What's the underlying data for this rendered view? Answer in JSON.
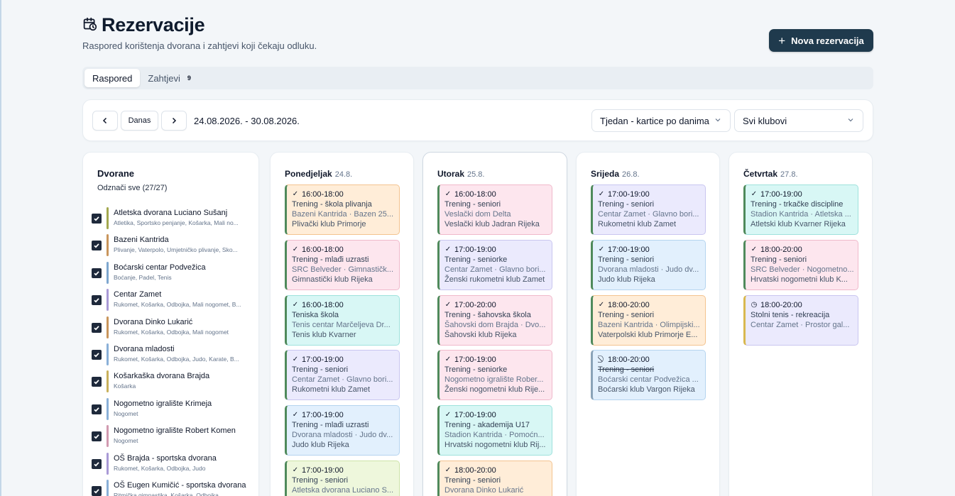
{
  "page": {
    "title": "Rezervacije",
    "subtitle": "Raspored korištenja dvorana i zahtjevi koji čekaju odluku.",
    "new_button": "Nova rezervacija"
  },
  "tabs": [
    {
      "label": "Raspored",
      "active": true
    },
    {
      "label": "Zahtjevi",
      "badge": "9"
    }
  ],
  "toolbar": {
    "today": "Danas",
    "range": "24.08.2026. - 30.08.2026.",
    "view_select": "Tjedan - kartice po danima",
    "club_select": "Svi klubovi"
  },
  "halls": {
    "title": "Dvorane",
    "select_all": "Odznači sve (27/27)",
    "items": [
      {
        "name": "Atletska dvorana Luciano Sušanj",
        "sports": "Atletika, Sportsko penjanje, Košarka, Mali no...",
        "color": "#a3a84f"
      },
      {
        "name": "Bazeni Kantrida",
        "sports": "Plivanje, Vaterpolo, Umjetničko plivanje, Sko...",
        "color": "#c9955c"
      },
      {
        "name": "Boćarski centar Podvežica",
        "sports": "Boćanje, Padel, Tenis",
        "color": "#7ea7cf"
      },
      {
        "name": "Centar Zamet",
        "sports": "Rukomet, Košarka, Odbojka, Mali nogomet, B...",
        "color": "#a99ad6"
      },
      {
        "name": "Dvorana Dinko Lukarić",
        "sports": "Rukomet, Košarka, Odbojka, Mali nogomet",
        "color": "#c9955c"
      },
      {
        "name": "Dvorana mladosti",
        "sports": "Rukomet, Košarka, Odbojka, Judo, Karate, B...",
        "color": "#8ab0d8"
      },
      {
        "name": "Košarkaška dvorana Brajda",
        "sports": "Košarka",
        "color": "#c9b15c"
      },
      {
        "name": "Nogometno igralište Krimeja",
        "sports": "Nogomet",
        "color": "#8ab0d8"
      },
      {
        "name": "Nogometno igralište Robert Komen",
        "sports": "Nogomet",
        "color": "#d19ab0"
      },
      {
        "name": "OŠ Brajda - sportska dvorana",
        "sports": "Rukomet, Košarka, Odbojka, Judo",
        "color": "#a99ad6"
      },
      {
        "name": "OŠ Eugen Kumičić - sportska dvorana",
        "sports": "Ritmička gimnastika, Košarka, Odbojka",
        "color": "#8ab0d8"
      }
    ]
  },
  "days": [
    {
      "name": "Ponedjeljak",
      "date": "24.8.",
      "cards": [
        {
          "icon": "✓",
          "time": "16:00-18:00",
          "title": "Trening - škola plivanja",
          "place": "Bazeni Kantrida · Bazen 25...",
          "club": "Plivački klub Primorje",
          "theme": "orange"
        },
        {
          "icon": "✓",
          "time": "16:00-18:00",
          "title": "Trening - mlađi uzrasti",
          "place": "SRC Belveder · Gimnastičk...",
          "club": "Gimnastički klub Rijeka",
          "theme": "pink"
        },
        {
          "icon": "✓",
          "time": "16:00-18:00",
          "title": "Teniska škola",
          "place": "Tenis centar Marčeljeva Dr...",
          "club": "Tenis klub Kvarner",
          "theme": "teal"
        },
        {
          "icon": "✓",
          "time": "17:00-19:00",
          "title": "Trening - seniori",
          "place": "Centar Zamet · Glavno bori...",
          "club": "Rukometni klub Zamet",
          "theme": "lavender"
        },
        {
          "icon": "✓",
          "time": "17:00-19:00",
          "title": "Trening - mlađi uzrasti",
          "place": "Dvorana mladosti · Judo dv...",
          "club": "Judo klub Rijeka",
          "theme": "blue"
        },
        {
          "icon": "✓",
          "time": "17:00-19:00",
          "title": "Trening - seniori",
          "place": "Atletska dvorana Luciano S...",
          "club": "",
          "theme": "olive"
        }
      ]
    },
    {
      "name": "Utorak",
      "date": "25.8.",
      "cards": [
        {
          "icon": "✓",
          "time": "16:00-18:00",
          "title": "Trening - seniori",
          "place": "Veslački dom Delta",
          "club": "Veslački klub Jadran Rijeka",
          "theme": "pink"
        },
        {
          "icon": "✓",
          "time": "17:00-19:00",
          "title": "Trening - seniorke",
          "place": "Centar Zamet · Glavno bori...",
          "club": "Ženski rukometni klub Zamet",
          "theme": "lavender"
        },
        {
          "icon": "✓",
          "time": "17:00-20:00",
          "title": "Trening - šahovska škola",
          "place": "Šahovski dom Brajda · Dvo...",
          "club": "Šahovski klub Rijeka",
          "theme": "pink"
        },
        {
          "icon": "✓",
          "time": "17:00-19:00",
          "title": "Trening - seniorke",
          "place": "Nogometno igralište Rober...",
          "club": "Ženski nogometni klub Rije...",
          "theme": "pink"
        },
        {
          "icon": "✓",
          "time": "17:00-19:00",
          "title": "Trening - akademija U17",
          "place": "Stadion Kantrida · Pomoćn...",
          "club": "Hrvatski nogometni klub Rij...",
          "theme": "teal"
        },
        {
          "icon": "✓",
          "time": "18:00-20:00",
          "title": "Trening - seniori",
          "place": "Dvorana Dinko Lukarić",
          "club": "",
          "theme": "orange"
        }
      ]
    },
    {
      "name": "Srijeda",
      "date": "26.8.",
      "cards": [
        {
          "icon": "✓",
          "time": "17:00-19:00",
          "title": "Trening - seniori",
          "place": "Centar Zamet · Glavno bori...",
          "club": "Rukometni klub Zamet",
          "theme": "lavender"
        },
        {
          "icon": "✓",
          "time": "17:00-19:00",
          "title": "Trening - seniori",
          "place": "Dvorana mladosti · Judo dv...",
          "club": "Judo klub Rijeka",
          "theme": "blue"
        },
        {
          "icon": "✓",
          "time": "18:00-20:00",
          "title": "Trening - seniori",
          "place": "Bazeni Kantrida · Olimpijski...",
          "club": "Vaterpolski klub Primorje E...",
          "theme": "orange"
        },
        {
          "icon": "⃠",
          "time": "18:00-20:00",
          "title": "Trening - seniori",
          "place": "Boćarski centar Podvežica ...",
          "club": "Boćarski klub Vargon Rijeka",
          "theme": "blue",
          "cancelled": true
        }
      ]
    },
    {
      "name": "Četvrtak",
      "date": "27.8.",
      "cards": [
        {
          "icon": "✓",
          "time": "17:00-19:00",
          "title": "Trening - trkačke discipline",
          "place": "Stadion Kantrida · Atletska ...",
          "club": "Atletski klub Kvarner Rijeka",
          "theme": "teal"
        },
        {
          "icon": "✓",
          "time": "18:00-20:00",
          "title": "Trening - seniori",
          "place": "SRC Belveder · Nogometno...",
          "club": "Hrvatski nogometni klub K...",
          "theme": "pink"
        },
        {
          "icon": "◷",
          "time": "18:00-20:00",
          "title": "Stolni tenis - rekreacija",
          "place": "Centar Zamet · Prostor gal...",
          "club": "",
          "theme": "lavender-pending"
        }
      ]
    }
  ]
}
